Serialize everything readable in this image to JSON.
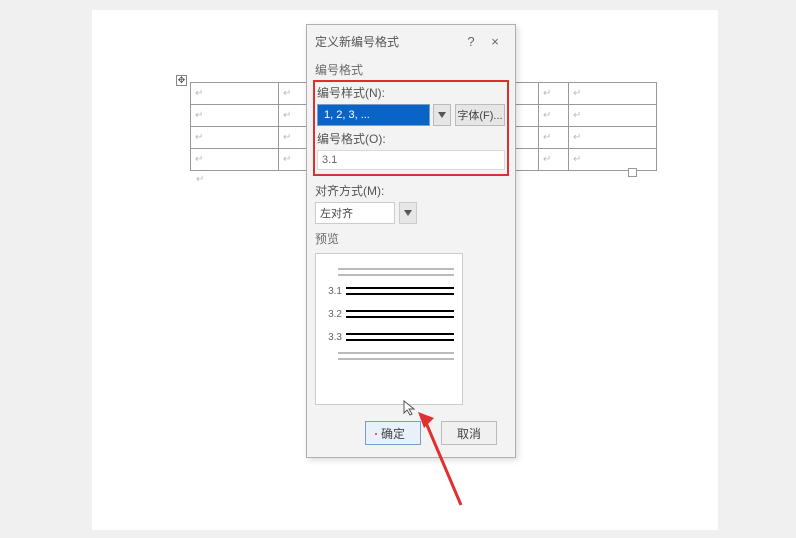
{
  "dialog": {
    "title": "定义新编号格式",
    "help": "?",
    "close": "×",
    "section_format": "编号格式",
    "label_style": "编号样式(N):",
    "style_value": "1, 2, 3, ...",
    "font_btn": "字体(F)...",
    "label_format": "编号格式(O):",
    "format_value": "3.1",
    "label_align": "对齐方式(M):",
    "align_value": "左对齐",
    "section_preview": "预览",
    "preview_nums": [
      "3.1",
      "3.2",
      "3.3"
    ],
    "ok": "确定",
    "cancel": "取消"
  },
  "table": {
    "mark": "↵",
    "anchor": "✥"
  }
}
